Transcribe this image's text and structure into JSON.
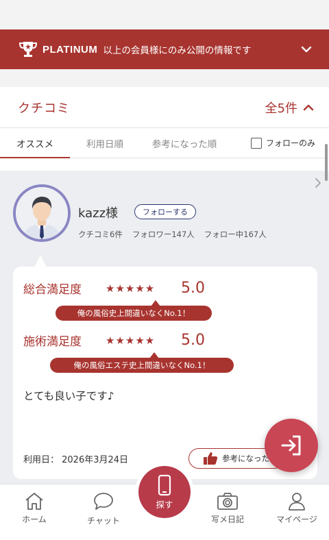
{
  "platinum_banner": {
    "badge": "PLATINUM",
    "text": "以上の会員様にのみ公開の情報です"
  },
  "reviews_header": {
    "title": "クチコミ",
    "count": "全5件"
  },
  "tabs": [
    {
      "label": "オススメ",
      "active": true
    },
    {
      "label": "利用日順",
      "active": false
    },
    {
      "label": "参考になった順",
      "active": false
    }
  ],
  "follow_only_label": "フォローのみ",
  "reviewer": {
    "name": "kazz様",
    "follow_button": "フォローする",
    "stats": {
      "reviews": "クチコミ6件",
      "followers": "フォロワー147人",
      "following": "フォロー中167人"
    }
  },
  "review": {
    "overall": {
      "label": "総合満足度",
      "stars": "★★★★★",
      "score": "5.0",
      "comment": "俺の風俗史上間違いなくNo.1！"
    },
    "treatment": {
      "label": "施術満足度",
      "stars": "★★★★★",
      "score": "5.0",
      "comment": "俺の風俗エステ史上間違いなくNo.1！"
    },
    "body": "とても良い子です♪",
    "usage_date": "利用日： 2026年3月24日",
    "helpful_button": "参考になった"
  },
  "bottom_nav": {
    "home": "ホーム",
    "chat": "チャット",
    "search": "探す",
    "photo_diary": "写メ日記",
    "mypage": "マイページ"
  },
  "colors": {
    "accent": "#a8342f",
    "fab": "#c94655",
    "follow_border": "#2a3570",
    "avatar_ring": "#8a86c3"
  }
}
